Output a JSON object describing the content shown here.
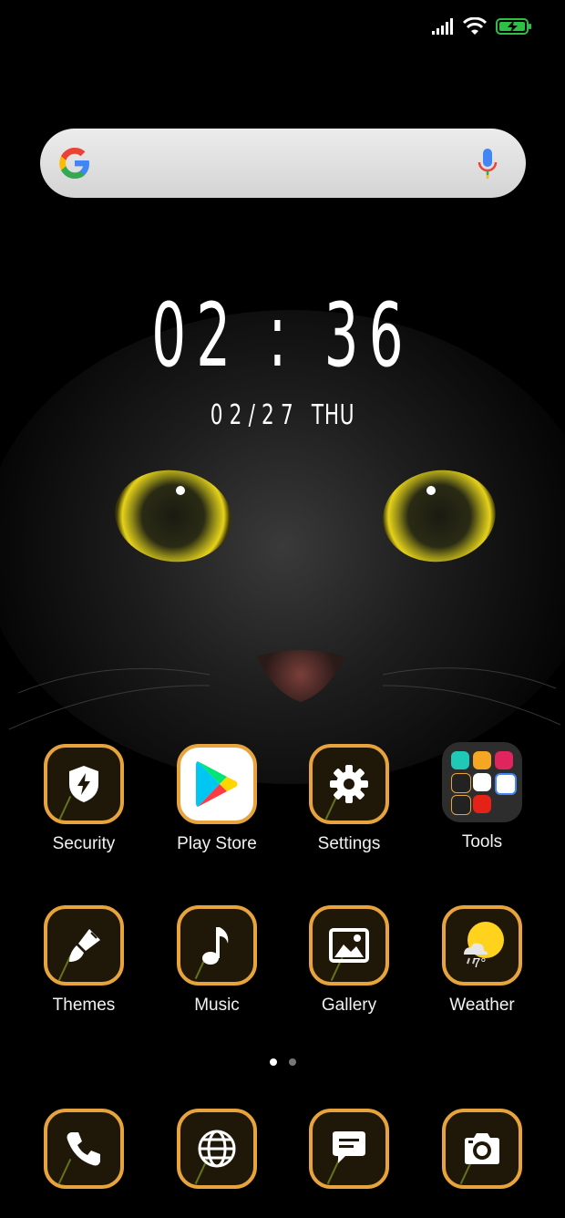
{
  "status_bar": {
    "signal_icon": "cell-signal-icon",
    "wifi_icon": "wifi-icon",
    "battery_icon": "battery-charging-icon",
    "battery_color": "#2fbf44"
  },
  "search": {
    "logo_icon": "google-g-icon",
    "mic_icon": "microphone-icon"
  },
  "clock": {
    "time": "02 : 36",
    "date": "02/27",
    "weekday": "THU"
  },
  "apps": [
    {
      "label": "Security",
      "icon": "shield-bolt-icon"
    },
    {
      "label": "Play Store",
      "icon": "play-store-icon"
    },
    {
      "label": "Settings",
      "icon": "gear-icon"
    },
    {
      "label": "Tools",
      "icon": "folder-icon"
    },
    {
      "label": "Themes",
      "icon": "paintbrush-icon"
    },
    {
      "label": "Music",
      "icon": "music-note-icon"
    },
    {
      "label": "Gallery",
      "icon": "image-icon"
    },
    {
      "label": "Weather",
      "icon": "weather-sun-cloud-icon",
      "temperature": "7°"
    }
  ],
  "page_indicator": {
    "pages": 2,
    "current": 1
  },
  "dock": [
    {
      "icon": "phone-icon"
    },
    {
      "icon": "globe-icon"
    },
    {
      "icon": "message-icon"
    },
    {
      "icon": "camera-icon"
    }
  ],
  "colors": {
    "icon_border": "#e8a43c",
    "icon_background": "#1f1708",
    "cat_eye": "#d8c21a"
  }
}
